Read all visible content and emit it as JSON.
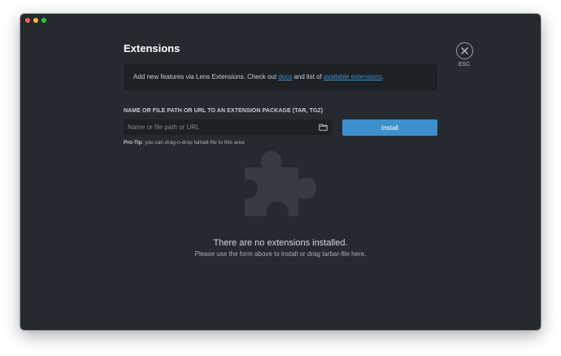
{
  "window": {
    "controls": [
      "close",
      "minimize",
      "maximize"
    ]
  },
  "page": {
    "title": "Extensions"
  },
  "esc": {
    "label": "ESC",
    "icon": "close-icon"
  },
  "info": {
    "text_before": "Add new features via Lens Extensions. Check out ",
    "docs_link": "docs",
    "text_middle": " and list of ",
    "available_link": "available extensions",
    "text_after": "."
  },
  "install_form": {
    "field_label": "NAME OR FILE PATH OR URL TO AN EXTENSION PACKAGE (TAR, TGZ)",
    "input_value": "",
    "input_placeholder": "Name or file path or URL",
    "browse_icon": "folder-icon",
    "install_label": "Install",
    "protip_bold": "Pro-Tip",
    "protip_text": ": you can drag-n-drop tarball-file to this area"
  },
  "empty_state": {
    "icon": "puzzle-icon",
    "title": "There are no extensions installed.",
    "subtitle": "Please use the form above to install or drag tarbar-file here."
  },
  "colors": {
    "background": "#262a2e",
    "panel": "#1e2124",
    "accent": "#3d90ce",
    "text": "#c8ccd0"
  }
}
